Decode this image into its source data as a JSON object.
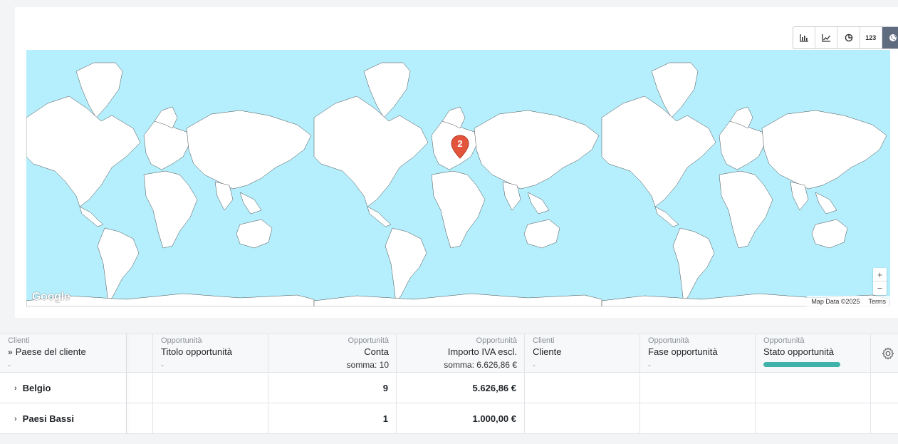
{
  "toolbar": {
    "buttons": [
      {
        "name": "bar-chart",
        "label": ""
      },
      {
        "name": "line-chart",
        "label": ""
      },
      {
        "name": "pie-chart",
        "label": ""
      },
      {
        "name": "number",
        "label": "123"
      },
      {
        "name": "map",
        "label": ""
      }
    ],
    "active": "map"
  },
  "map": {
    "marker_count": "2",
    "marker_color": "#e2543b",
    "water_color": "#b5eefc",
    "google_logo": "Google",
    "map_data": "Map Data ©2025",
    "terms": "Terms",
    "zoom_in": "+",
    "zoom_out": "−"
  },
  "table": {
    "columns": [
      {
        "group": "Clienti",
        "title": "Paese del cliente",
        "sub": "-"
      },
      {
        "group": "Opportunità",
        "title": "Titolo opportunità",
        "sub": "-"
      },
      {
        "group": "Opportunità",
        "title": "Conta",
        "sum": "somma: 10"
      },
      {
        "group": "Opportunità",
        "title": "Importo IVA escl.",
        "sum": "somma: 6.626,86 €"
      },
      {
        "group": "Clienti",
        "title": "Cliente",
        "sub": "-"
      },
      {
        "group": "Opportunità",
        "title": "Fase opportunità",
        "sub": "-"
      },
      {
        "group": "Opportunità",
        "title": "Stato opportunità"
      }
    ],
    "status_bar_color": "#3fb3ab",
    "rows": [
      {
        "country": "Belgio",
        "count": "9",
        "amount": "5.626,86 €"
      },
      {
        "country": "Paesi Bassi",
        "count": "1",
        "amount": "1.000,00 €"
      }
    ]
  }
}
